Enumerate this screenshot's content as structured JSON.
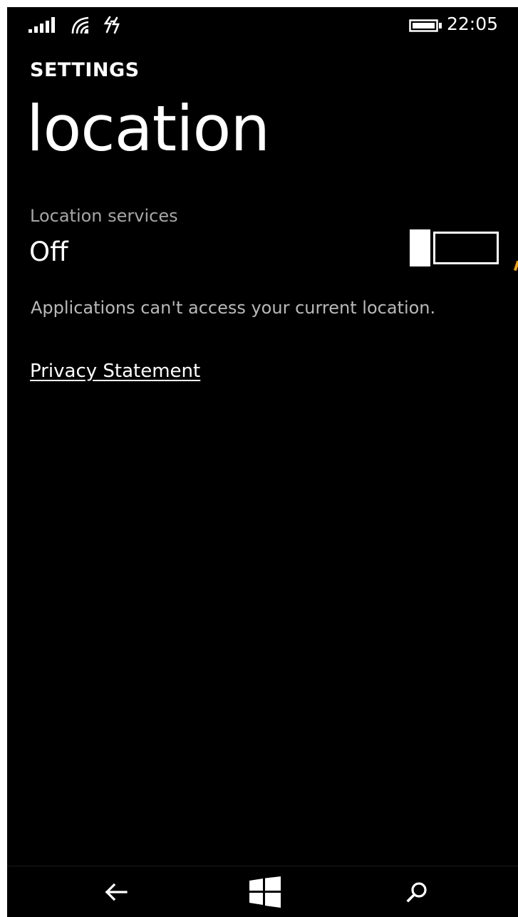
{
  "status_bar": {
    "time": "22:05",
    "icons": [
      "signal-strength-icon",
      "wifi-icon",
      "mobile-data-icon",
      "battery-icon"
    ]
  },
  "header": {
    "section": "SETTINGS",
    "title": "location"
  },
  "location_services": {
    "label": "Location services",
    "state": "Off",
    "enabled": false,
    "description": "Applications can't access your current location."
  },
  "links": {
    "privacy": "Privacy Statement"
  },
  "nav_bar": {
    "buttons": [
      "back-arrow-icon",
      "windows-start-icon",
      "search-icon"
    ]
  },
  "colors": {
    "background": "#000000",
    "foreground": "#ffffff",
    "secondary_text": "#a6a6a6",
    "accent": "#f0a30a"
  }
}
